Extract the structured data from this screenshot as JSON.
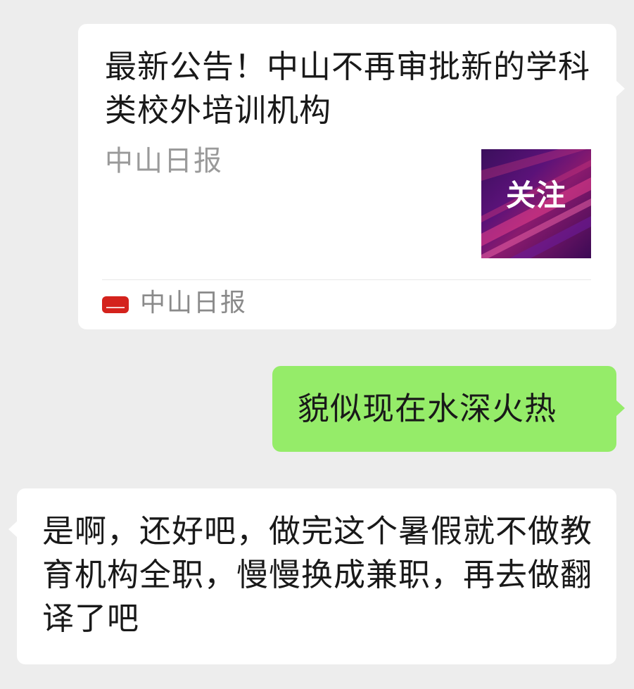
{
  "messages": {
    "article_card": {
      "title": "最新公告！中山不再审批新的学科类校外培训机构",
      "source": "中山日报",
      "thumbnail_label": "关注",
      "thumbnail_colors": [
        "#3a0f5c",
        "#8a1a6e",
        "#e8408c"
      ],
      "footer_account": "中山日报",
      "footer_logo_text": "中山日报",
      "footer_logo_color": "#d4221c"
    },
    "sent_text": "貌似现在水深火热",
    "received_text": "是啊，还好吧，做完这个暑假就不做教育机构全职，慢慢换成兼职，再去做翻译了吧"
  },
  "colors": {
    "background": "#ededed",
    "sent_bubble": "#95ec69",
    "received_bubble": "#ffffff",
    "text": "#191919",
    "muted_text": "#9a9a9a"
  }
}
